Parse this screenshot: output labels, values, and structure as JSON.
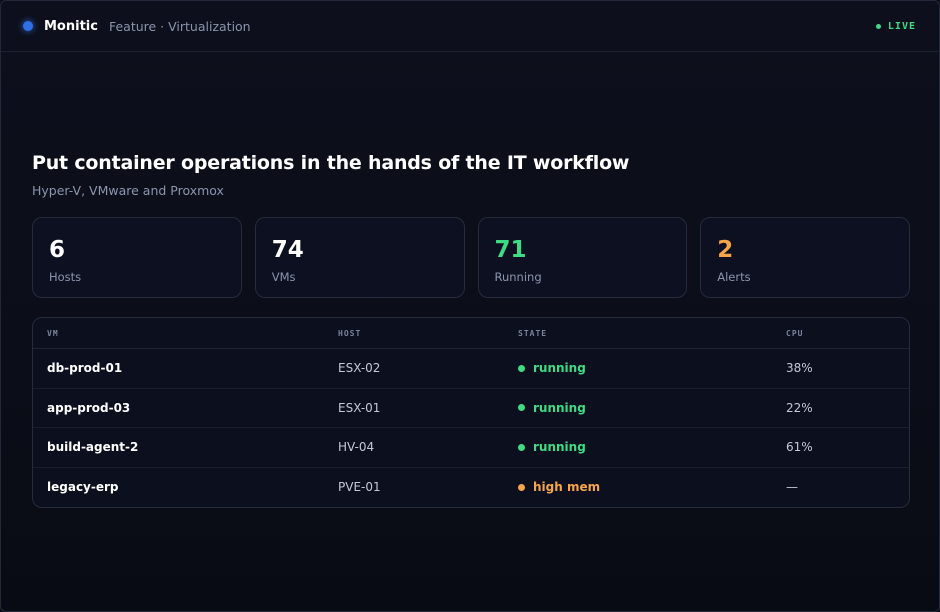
{
  "header": {
    "brand": "Monitic",
    "breadcrumb": "Feature · Virtualization",
    "status": "LIVE"
  },
  "hero": {
    "title": "Put container operations in the hands of the IT workflow",
    "subtitle": "Hyper-V, VMware and Proxmox"
  },
  "stats": [
    {
      "value": "6",
      "label": "Hosts",
      "color": "#ffffff"
    },
    {
      "value": "74",
      "label": "VMs",
      "color": "#ffffff"
    },
    {
      "value": "71",
      "label": "Running",
      "color": "#3ddc84"
    },
    {
      "value": "2",
      "label": "Alerts",
      "color": "#f5a54a"
    }
  ],
  "table": {
    "columns": [
      "VM",
      "HOST",
      "STATE",
      "CPU"
    ],
    "rows": [
      {
        "vm": "db-prod-01",
        "host": "ESX-02",
        "state": "running",
        "state_color": "#3ddc84",
        "cpu": "38%"
      },
      {
        "vm": "app-prod-03",
        "host": "ESX-01",
        "state": "running",
        "state_color": "#3ddc84",
        "cpu": "22%"
      },
      {
        "vm": "build-agent-2",
        "host": "HV-04",
        "state": "running",
        "state_color": "#3ddc84",
        "cpu": "61%"
      },
      {
        "vm": "legacy-erp",
        "host": "PVE-01",
        "state": "high mem",
        "state_color": "#f5a54a",
        "cpu": "—"
      }
    ]
  },
  "colors": {
    "accent": "#2f6fe8",
    "live": "#3ddc84",
    "ok": "#3ddc84",
    "warn": "#f5a54a"
  }
}
